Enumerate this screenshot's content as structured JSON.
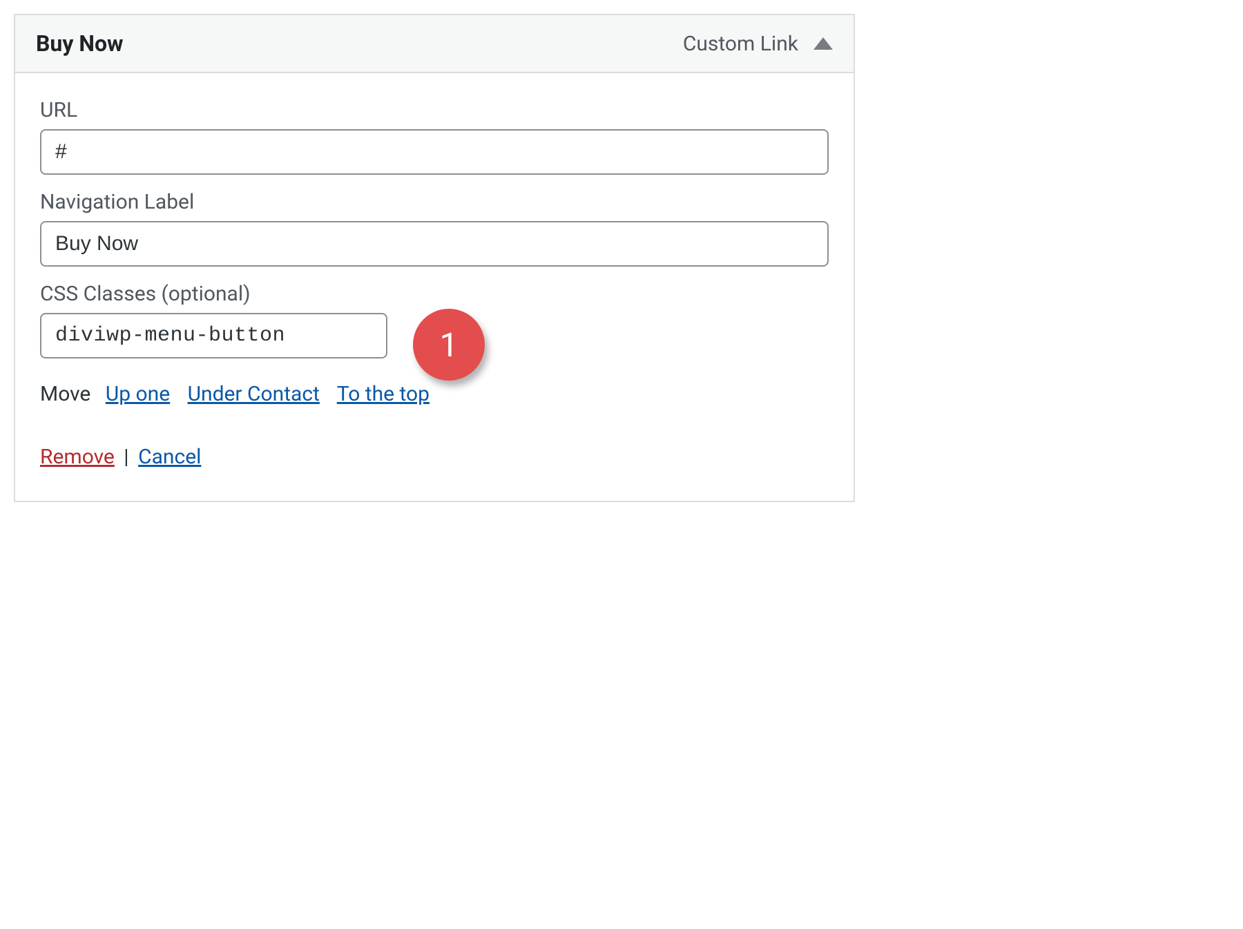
{
  "header": {
    "title": "Buy Now",
    "type_label": "Custom Link"
  },
  "fields": {
    "url": {
      "label": "URL",
      "value": "#"
    },
    "nav_label": {
      "label": "Navigation Label",
      "value": "Buy Now"
    },
    "css_classes": {
      "label": "CSS Classes (optional)",
      "value": "diviwp-menu-button"
    }
  },
  "annotation": {
    "badge_number": "1"
  },
  "move": {
    "label": "Move",
    "up_one": "Up one",
    "under_contact": "Under Contact",
    "to_top": "To the top"
  },
  "actions": {
    "remove": "Remove",
    "separator": "|",
    "cancel": "Cancel"
  }
}
